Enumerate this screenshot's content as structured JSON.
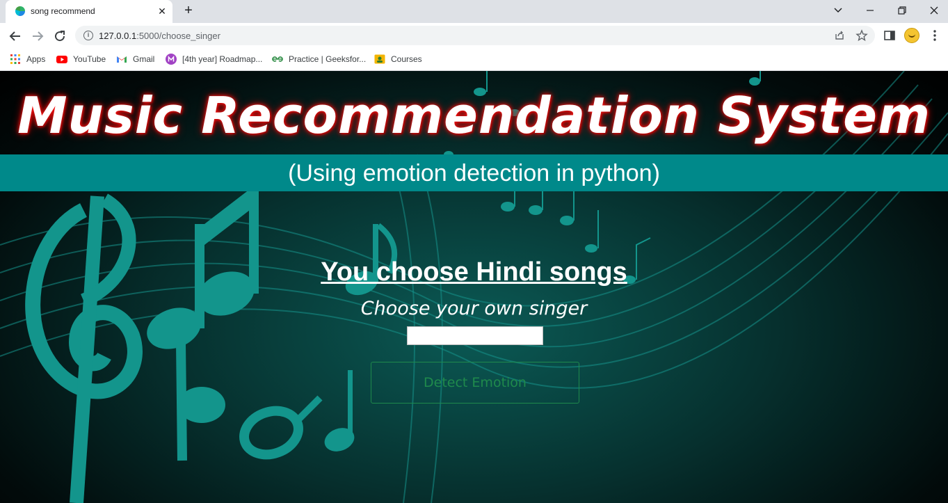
{
  "browser": {
    "tab_title": "song recommend",
    "url_host": "127.0.0.1",
    "url_path": ":5000/choose_singer",
    "bookmarks": [
      {
        "label": "Apps",
        "icon": "apps-grid-icon"
      },
      {
        "label": "YouTube",
        "icon": "youtube-icon"
      },
      {
        "label": "Gmail",
        "icon": "gmail-icon"
      },
      {
        "label": "[4th year] Roadmap...",
        "icon": "m-badge-icon"
      },
      {
        "label": "Practice | Geeksfor...",
        "icon": "geeksforgeeks-icon"
      },
      {
        "label": "Courses",
        "icon": "courses-icon"
      }
    ]
  },
  "page": {
    "title": "Music Recommendation System",
    "subtitle": "(Using emotion detection in python)",
    "choice": "You choose Hindi songs",
    "prompt": "Choose your own singer",
    "singer_input_value": "",
    "button_label": "Detect Emotion"
  },
  "colors": {
    "banner": "#00898a",
    "title_glow": "#ff1a1a",
    "button_accent": "#1f8a4c",
    "note_teal": "#13958c"
  }
}
